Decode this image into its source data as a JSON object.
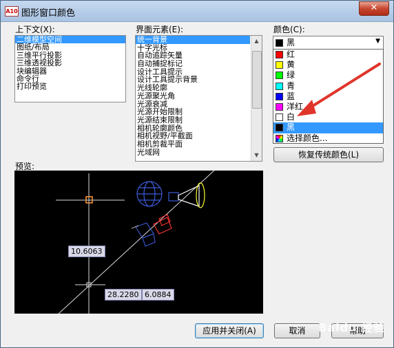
{
  "window": {
    "title": "图形窗口颜色",
    "app_icon": "A10",
    "close_glyph": "✕"
  },
  "context": {
    "label": "上下文(X):",
    "items": [
      "二维模型空间",
      "图纸/布局",
      "三维平行投影",
      "三维透视投影",
      "块编辑器",
      "命令行",
      "打印预览"
    ],
    "selected_index": 0
  },
  "interface": {
    "label": "界面元素(E):",
    "items": [
      "统一背景",
      "十字光标",
      "自动追踪矢量",
      "自动捕捉标记",
      "设计工具提示",
      "设计工具提示背景",
      "光线轮廓",
      "光源聚光角",
      "光源衰减",
      "光源开始限制",
      "光源结束限制",
      "相机轮廓颜色",
      "相机视野/平截面",
      "相机剪裁平面",
      "光域网"
    ],
    "selected_index": 0
  },
  "color": {
    "label": "颜色(C):",
    "selected": {
      "name": "黑",
      "hex": "#000000"
    },
    "options": [
      {
        "name": "红",
        "hex": "#ff0000"
      },
      {
        "name": "黄",
        "hex": "#ffff00"
      },
      {
        "name": "绿",
        "hex": "#00ff00"
      },
      {
        "name": "青",
        "hex": "#00ffff"
      },
      {
        "name": "蓝",
        "hex": "#0000ff"
      },
      {
        "name": "洋红",
        "hex": "#ff00ff"
      },
      {
        "name": "白",
        "hex": "#ffffff"
      },
      {
        "name": "黑",
        "hex": "#000000"
      },
      {
        "name": "选择颜色...",
        "hex": ""
      }
    ],
    "highlighted_index": 7
  },
  "buttons": {
    "restore": "恢复传统颜色(L)",
    "apply_close": "应用并关闭(A)",
    "cancel": "取消",
    "help": "帮助"
  },
  "preview": {
    "label": "预览:",
    "dimension_values": [
      "10.6063",
      "28.2280",
      "6.0884"
    ]
  },
  "watermark": "Baidu 经验",
  "colors": {
    "accent": "#3399ff",
    "annotation_arrow": "#e0352b"
  }
}
